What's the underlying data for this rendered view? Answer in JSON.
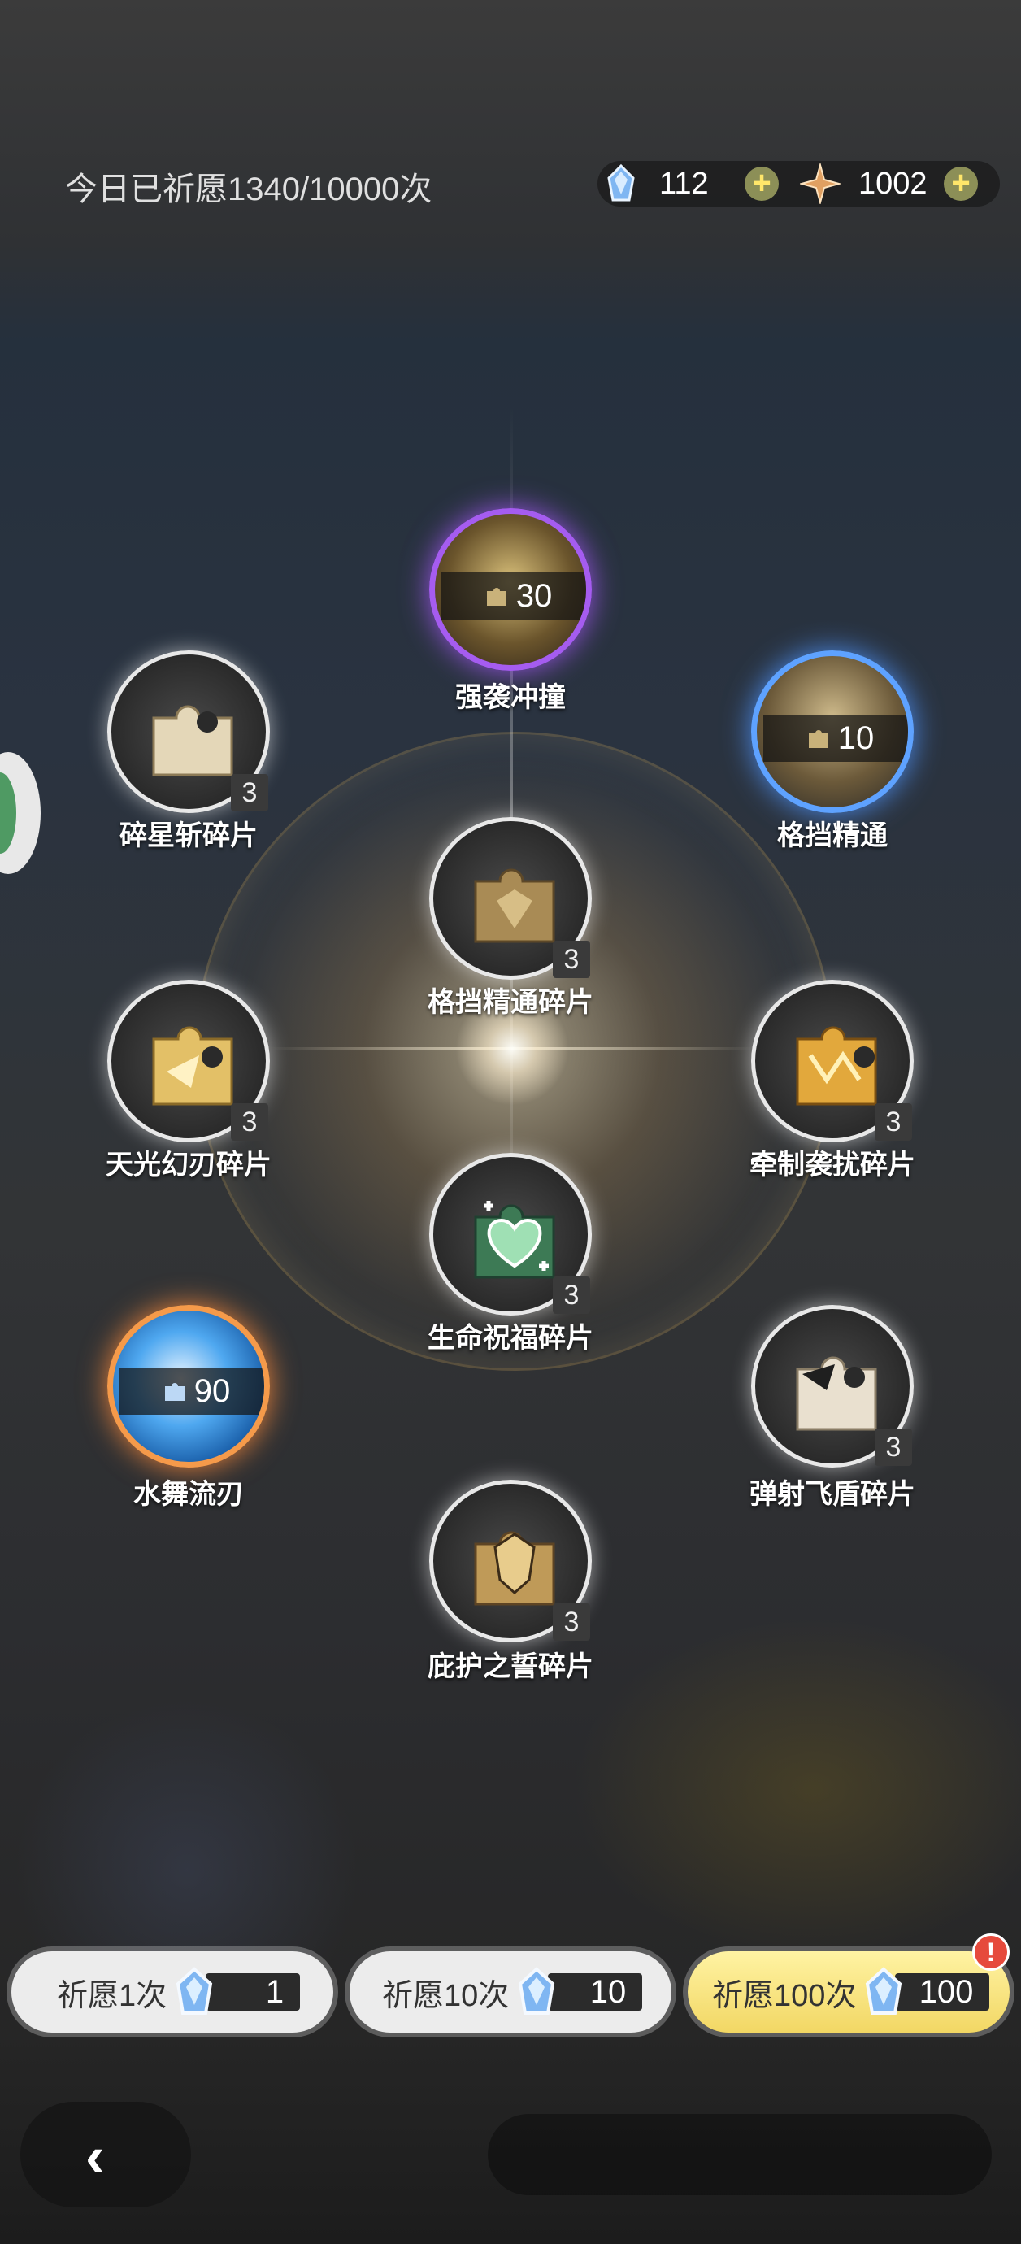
{
  "header": {
    "wish_count": "今日已祈愿1340/10000次",
    "currencies": [
      {
        "icon": "crystal-icon",
        "value": "112"
      },
      {
        "icon": "star-gem-icon",
        "value": "1002"
      }
    ],
    "plus_symbol": "+"
  },
  "nodes": [
    {
      "name": "强袭冲撞",
      "cost": "30",
      "rarity": "purple"
    },
    {
      "name": "碎星斩碎片",
      "count": "3"
    },
    {
      "name": "格挡精通",
      "cost": "10",
      "rarity": "blue"
    },
    {
      "name": "格挡精通碎片",
      "count": "3"
    },
    {
      "name": "天光幻刃碎片",
      "count": "3"
    },
    {
      "name": "牵制袭扰碎片",
      "count": "3"
    },
    {
      "name": "生命祝福碎片",
      "count": "3"
    },
    {
      "name": "水舞流刃",
      "cost": "90",
      "rarity": "orange"
    },
    {
      "name": "弹射飞盾碎片",
      "count": "3"
    },
    {
      "name": "庇护之誓碎片",
      "count": "3"
    }
  ],
  "buttons": [
    {
      "label": "祈愿1次",
      "cost": "1"
    },
    {
      "label": "祈愿10次",
      "cost": "10"
    },
    {
      "label": "祈愿100次",
      "cost": "100",
      "alert": "!"
    }
  ],
  "back_symbol": "‹",
  "colors": {
    "accent_gold": "#f2d764",
    "purple_rarity": "#a55cf0",
    "blue_rarity": "#5ea2ff",
    "orange_rarity": "#f59a4a",
    "alert_red": "#e64a3c"
  }
}
